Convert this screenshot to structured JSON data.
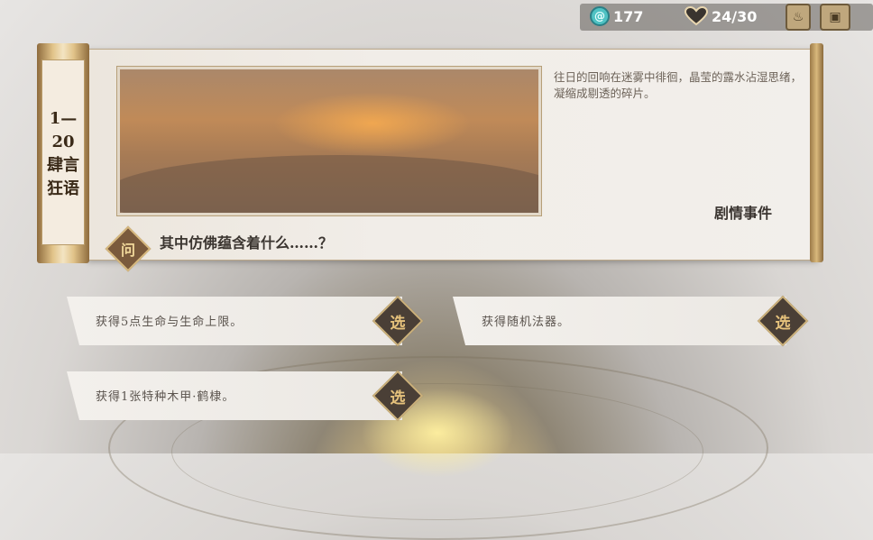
{
  "resources": {
    "coins": "177",
    "health": "24/30"
  },
  "stage": {
    "label": "1—\n20\n肆言\n狂语"
  },
  "event": {
    "description": "往日的回响在迷雾中徘徊，晶莹的露水沾湿思绪，凝缩成剔透的碎片。",
    "type_label": "剧情事件",
    "question_badge": "问",
    "question": "其中仿佛蕴含着什么……？"
  },
  "options": [
    {
      "text": "获得5点生命与生命上限。",
      "button": "选"
    },
    {
      "text": "获得随机法器。",
      "button": "选"
    },
    {
      "text": "获得1张特种木甲·鹤棣。",
      "button": "选"
    }
  ],
  "icons": {
    "coin": "spiral-coin-icon",
    "health": "heart-icon",
    "skill": "flame-icon",
    "bag": "backpack-icon"
  }
}
